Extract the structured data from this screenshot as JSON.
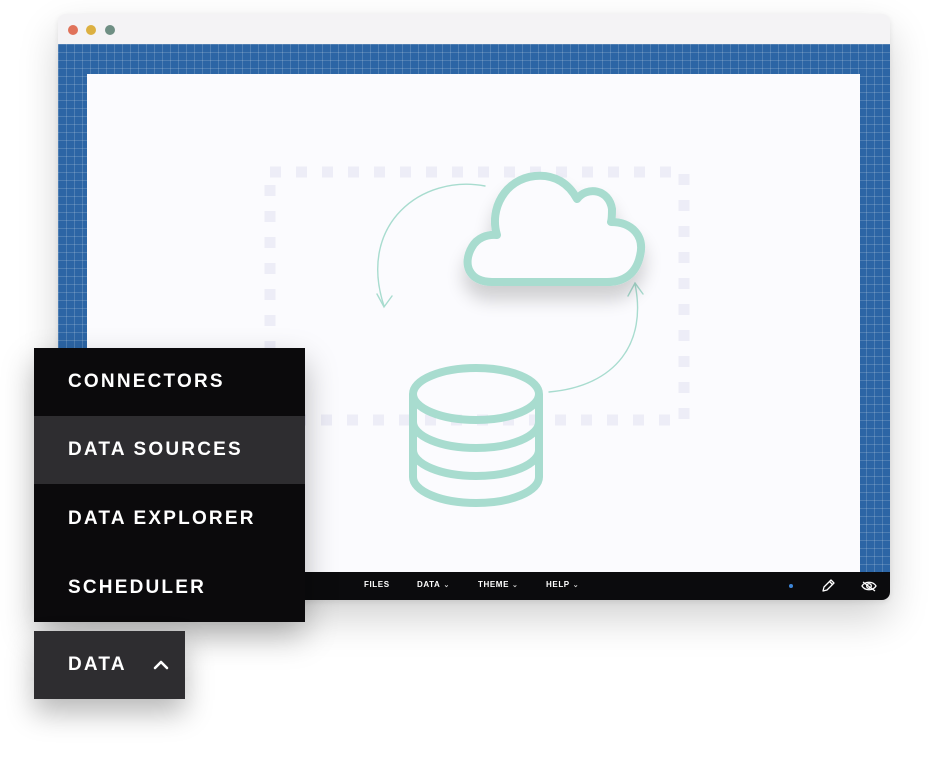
{
  "window": {
    "traffic_lights": {
      "close": "#e0725a",
      "minimize": "#dcb041",
      "zoom": "#6f8f84"
    }
  },
  "canvas": {
    "grid_color": "#2c65a5",
    "illustration": {
      "icons": [
        "cloud-icon",
        "database-icon",
        "sync-arrows-icon"
      ],
      "accent_color": "#a8dccf"
    }
  },
  "toolbar": {
    "files_label": "FILES",
    "data_label": "DATA",
    "theme_label": "THEME",
    "help_label": "HELP",
    "icons": [
      "edit-pencil-icon",
      "preview-eye-icon"
    ]
  },
  "menu": {
    "items": [
      {
        "label": "CONNECTORS",
        "active": false
      },
      {
        "label": "DATA SOURCES",
        "active": true
      },
      {
        "label": "DATA EXPLORER",
        "active": false
      },
      {
        "label": "SCHEDULER",
        "active": false
      }
    ]
  },
  "data_button": {
    "label": "DATA",
    "icon": "chevron-up-icon"
  }
}
